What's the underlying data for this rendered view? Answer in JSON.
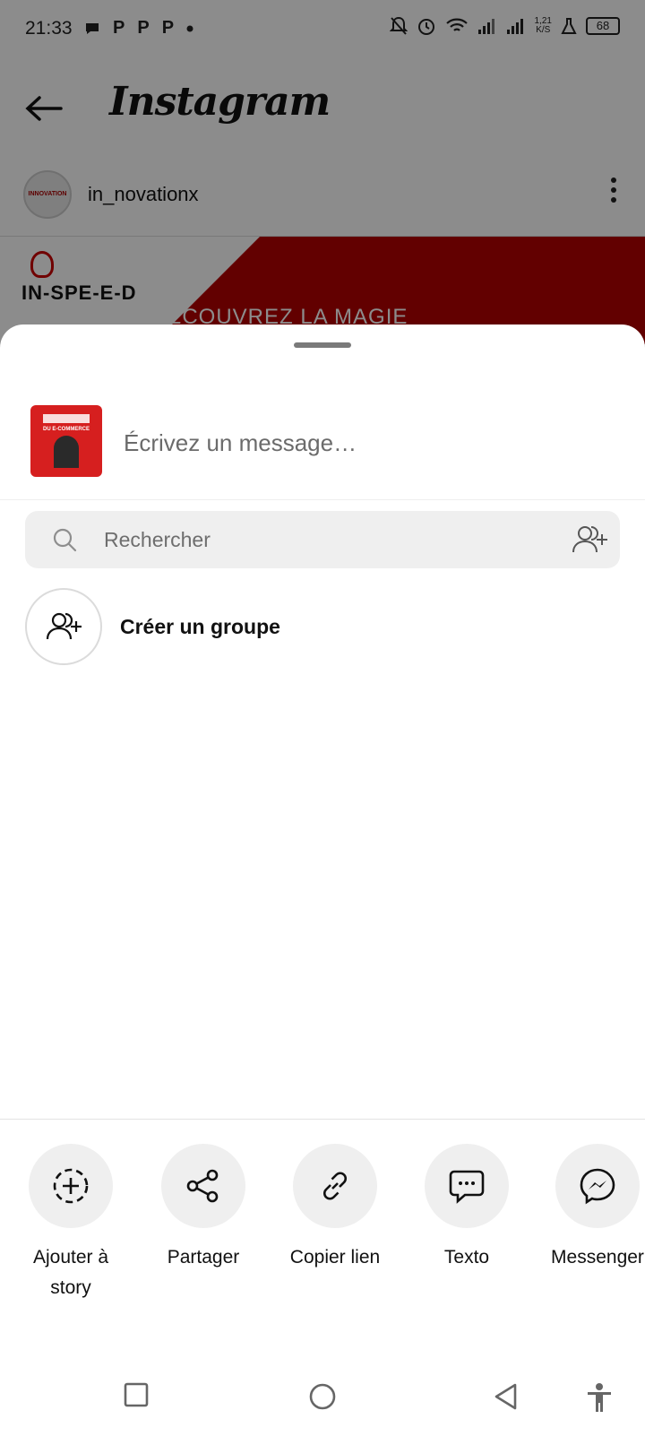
{
  "status_bar": {
    "time": "21:33",
    "notification_icons": [
      "P",
      "P",
      "P"
    ],
    "net_speed": "1,21\nK/S",
    "battery": "68"
  },
  "background": {
    "app_title": "Instagram",
    "post_username": "in_novationx",
    "avatar_text": "INNOVATION",
    "brand_text": "IN-SPE-E-D",
    "post_tagline": "DÉCOUVREZ LA MAGIE"
  },
  "sheet": {
    "thumb_text": "DU E-COMMERCE",
    "message_placeholder": "Écrivez un message…",
    "search_placeholder": "Rechercher",
    "create_group_label": "Créer un groupe",
    "share_actions": [
      {
        "label": "Ajouter à story",
        "icon": "add-story-icon"
      },
      {
        "label": "Partager",
        "icon": "share-icon"
      },
      {
        "label": "Copier lien",
        "icon": "link-icon"
      },
      {
        "label": "Texto",
        "icon": "sms-icon"
      },
      {
        "label": "Messenger",
        "icon": "messenger-icon"
      }
    ]
  },
  "colors": {
    "brand_red": "#b30000",
    "sheet_bg": "#ffffff",
    "chip_bg": "#efefef"
  }
}
